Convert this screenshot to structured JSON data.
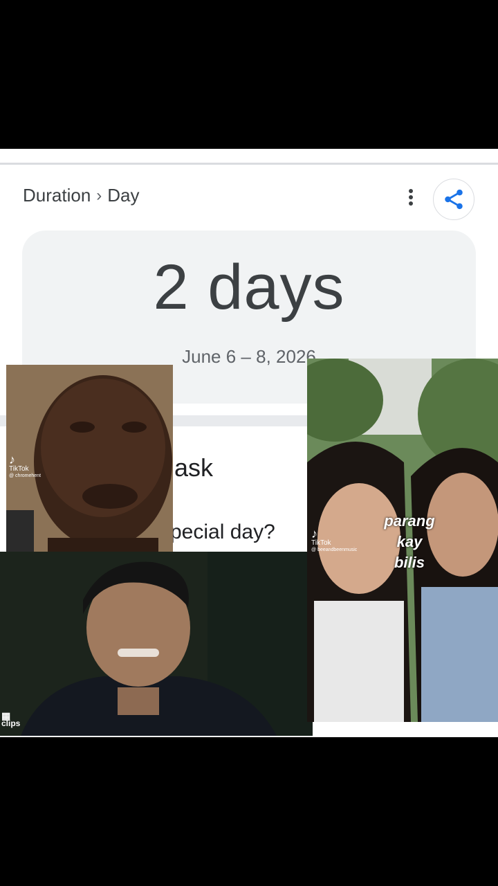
{
  "breadcrumb": {
    "first": "Duration",
    "separator": "›",
    "second": "Day"
  },
  "result": {
    "value": "2 days",
    "date_range": "June 6 – 8, 2026"
  },
  "partial_texts": {
    "ask": "ask",
    "special": "pecial day?"
  },
  "icons": {
    "more": "more-vert-icon",
    "share": "share-icon"
  },
  "overlays": {
    "video1": {
      "brand": "TikTok",
      "handle": "@ chromehent"
    },
    "video2": {
      "brand": "TikTok",
      "handle": "@ beeandbeenmusic",
      "caption_lines": [
        "parang",
        "kay",
        "bilis"
      ]
    },
    "video3": {
      "brand": "clips"
    }
  },
  "colors": {
    "accent": "#1a73e8",
    "text": "#3c4043",
    "card_bg": "#f1f3f4"
  }
}
